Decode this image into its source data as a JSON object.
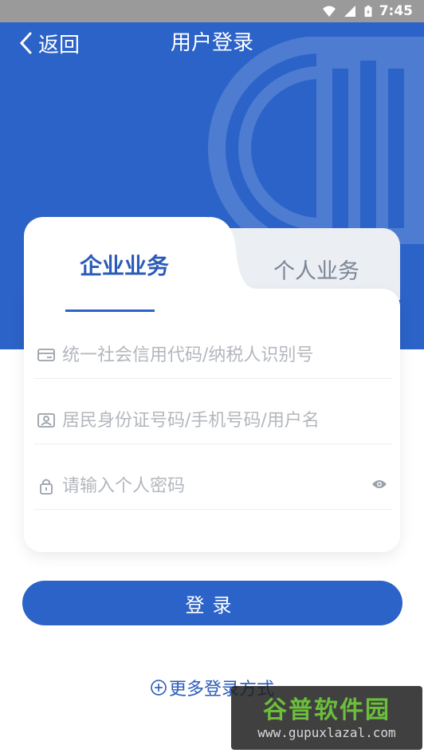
{
  "status_bar": {
    "time": "7:45"
  },
  "nav": {
    "back_label": "返回",
    "title": "用户登录"
  },
  "tabs": [
    {
      "label": "企业业务",
      "active": true
    },
    {
      "label": "个人业务",
      "active": false
    }
  ],
  "fields": {
    "credit_code": {
      "placeholder": "统一社会信用代码/纳税人识别号",
      "icon": "id-card-icon"
    },
    "id_number": {
      "placeholder": "居民身份证号码/手机号码/用户名",
      "icon": "person-card-icon"
    },
    "password": {
      "placeholder": "请输入个人密码",
      "icon": "lock-icon"
    }
  },
  "login_button": {
    "label": "登录"
  },
  "more_login": {
    "label": "更多登录方式"
  },
  "watermark": {
    "title": "谷普软件园",
    "url": "www.gupuxlazal.com"
  },
  "colors": {
    "primary": "#2c63c8",
    "tab_text_active": "#2a5bb8",
    "tab_text_inactive": "#7b8594"
  }
}
